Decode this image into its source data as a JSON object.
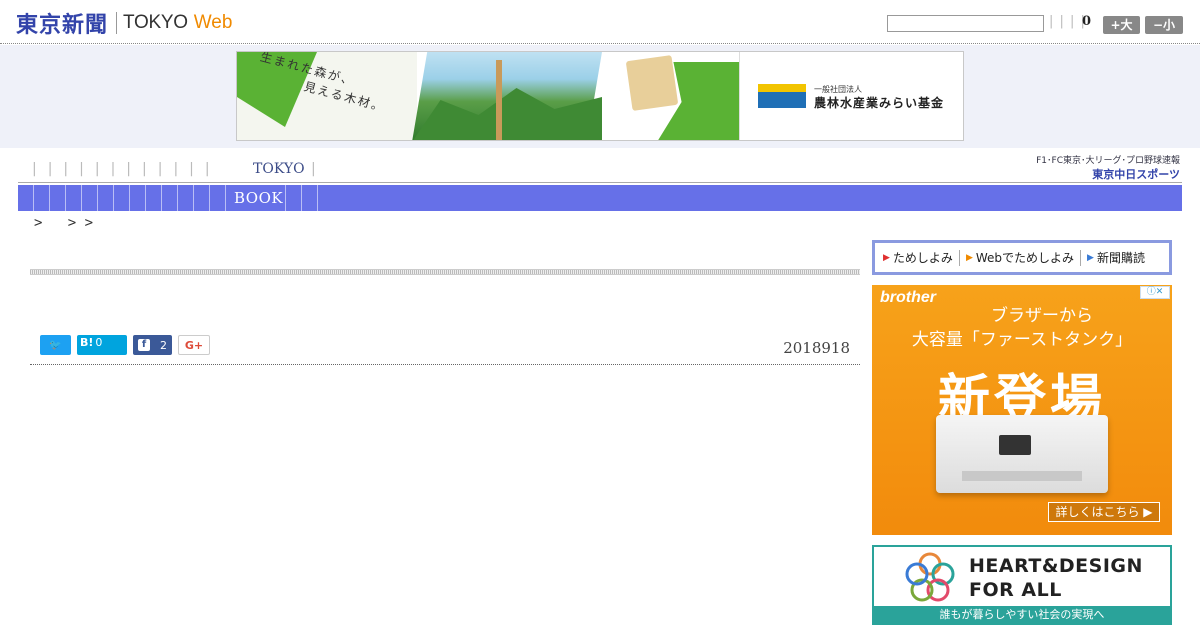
{
  "header": {
    "logo_jp": "東京新聞",
    "logo_en": "TOKYO",
    "logo_web": "Web",
    "search_value": "",
    "pipes": "| | | |",
    "count": "0",
    "font_large": "+大",
    "font_small": "−小"
  },
  "banner": {
    "text1": "生まれた森が、",
    "text2": "見える木材。",
    "org_small": "一般社団法人",
    "org": "農林水産業みらい基金"
  },
  "nav": {
    "pipes": "||||||||||||",
    "tokyo": "TOKYO",
    "tokyo_pipe": "|",
    "book": "BOOK",
    "chunichi_small": "F1･FC東京･大リーグ･プロ野球速報",
    "chunichi_big": "東京中日スポーツ"
  },
  "breadcrumb": ">   > >",
  "share": {
    "twitter": "🐦",
    "hatena": "B!",
    "hatena_count": "0",
    "facebook_icon": "f",
    "facebook_count": "2",
    "googleplus": "G+"
  },
  "article": {
    "date": "2018918"
  },
  "sidebar": {
    "tame1": "ためしよみ",
    "tame2": "Webでためしよみ",
    "tame3": "新聞購読",
    "ad1": {
      "adchoices": "ⓘ✕",
      "brand": "brother",
      "line1": "ブラザーから",
      "line2": "大容量「ファーストタンク」",
      "big": "新登場",
      "cta": "詳しくはこちら ▶"
    },
    "ad2": {
      "line1": "HEART&DESIGN",
      "line2": "FOR ALL",
      "foot": "誰もが暮らしやすい社会の実現へ"
    }
  },
  "colors": {
    "nav_bar": "#6670e8",
    "logo_blue": "#3344aa",
    "web_orange": "#f08a00",
    "ad_orange": "#f28b0c",
    "ad2_teal": "#2aa39a"
  }
}
